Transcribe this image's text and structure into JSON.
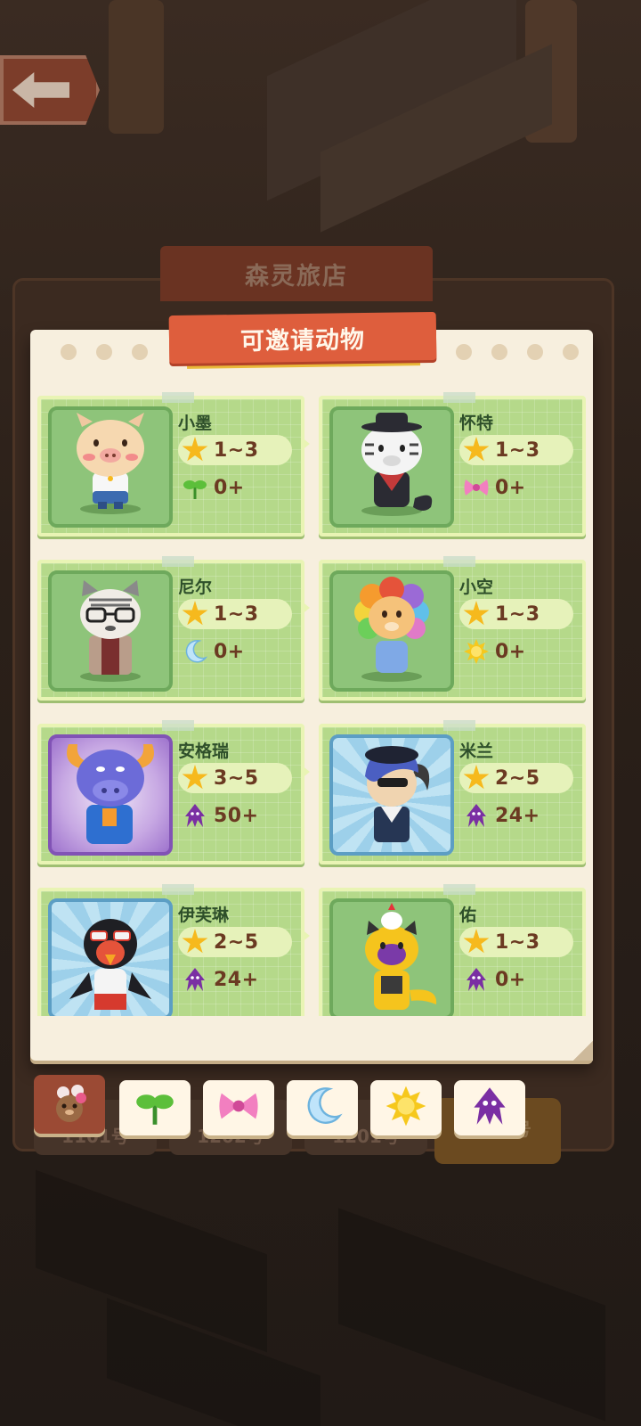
{
  "hotel": {
    "title": "森灵旅店",
    "rooms": [
      "1101号",
      "1202号",
      "1201号",
      "1203号"
    ]
  },
  "popup": {
    "title": "可邀请动物"
  },
  "animals": [
    {
      "name": "小墨",
      "stars": "1~3",
      "req_icon": "sprout-icon",
      "req": "0+",
      "portrait": "pig"
    },
    {
      "name": "怀特",
      "stars": "1~3",
      "req_icon": "bow-icon",
      "req": "0+",
      "portrait": "zebra"
    },
    {
      "name": "尼尔",
      "stars": "1~3",
      "req_icon": "moon-icon",
      "req": "0+",
      "portrait": "cat-glasses"
    },
    {
      "name": "小空",
      "stars": "1~3",
      "req_icon": "sun-icon",
      "req": "0+",
      "portrait": "lion"
    },
    {
      "name": "安格瑞",
      "stars": "3~5",
      "req_icon": "squid-icon",
      "req": "50+",
      "portrait": "bull"
    },
    {
      "name": "米兰",
      "stars": "2~5",
      "req_icon": "squid-icon",
      "req": "24+",
      "portrait": "goat"
    },
    {
      "name": "伊芙琳",
      "stars": "2~5",
      "req_icon": "squid-icon",
      "req": "24+",
      "portrait": "bird"
    },
    {
      "name": "佑",
      "stars": "1~3",
      "req_icon": "squid-icon",
      "req": "0+",
      "portrait": "tiger"
    }
  ],
  "filters": [
    "all-animals-icon",
    "sprout-icon",
    "bow-icon",
    "moon-icon",
    "sun-icon",
    "squid-icon"
  ],
  "colors": {
    "card_green": "#b5d98a",
    "ribbon_red": "#de5e3d",
    "star_yellow": "#f6b91d",
    "value_brown": "#6b3a22",
    "squid_purple": "#7a2fa3"
  }
}
